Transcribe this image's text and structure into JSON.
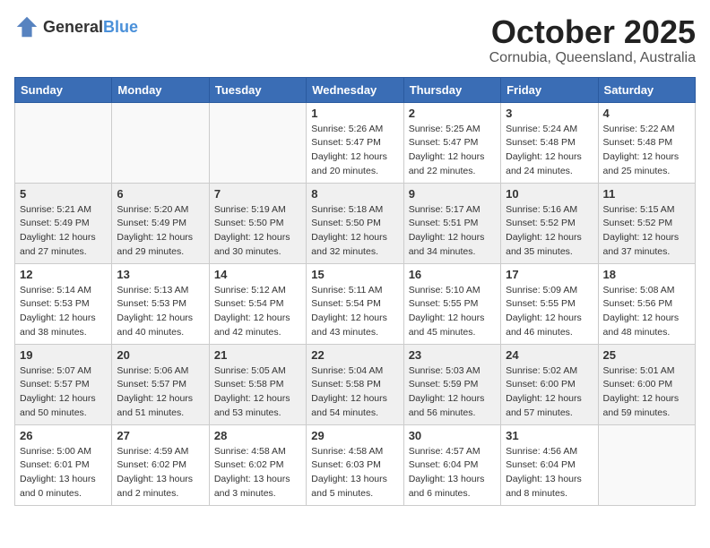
{
  "header": {
    "logo_general": "General",
    "logo_blue": "Blue",
    "month": "October 2025",
    "location": "Cornubia, Queensland, Australia"
  },
  "weekdays": [
    "Sunday",
    "Monday",
    "Tuesday",
    "Wednesday",
    "Thursday",
    "Friday",
    "Saturday"
  ],
  "weeks": [
    [
      {
        "day": "",
        "info": ""
      },
      {
        "day": "",
        "info": ""
      },
      {
        "day": "",
        "info": ""
      },
      {
        "day": "1",
        "info": "Sunrise: 5:26 AM\nSunset: 5:47 PM\nDaylight: 12 hours\nand 20 minutes."
      },
      {
        "day": "2",
        "info": "Sunrise: 5:25 AM\nSunset: 5:47 PM\nDaylight: 12 hours\nand 22 minutes."
      },
      {
        "day": "3",
        "info": "Sunrise: 5:24 AM\nSunset: 5:48 PM\nDaylight: 12 hours\nand 24 minutes."
      },
      {
        "day": "4",
        "info": "Sunrise: 5:22 AM\nSunset: 5:48 PM\nDaylight: 12 hours\nand 25 minutes."
      }
    ],
    [
      {
        "day": "5",
        "info": "Sunrise: 5:21 AM\nSunset: 5:49 PM\nDaylight: 12 hours\nand 27 minutes."
      },
      {
        "day": "6",
        "info": "Sunrise: 5:20 AM\nSunset: 5:49 PM\nDaylight: 12 hours\nand 29 minutes."
      },
      {
        "day": "7",
        "info": "Sunrise: 5:19 AM\nSunset: 5:50 PM\nDaylight: 12 hours\nand 30 minutes."
      },
      {
        "day": "8",
        "info": "Sunrise: 5:18 AM\nSunset: 5:50 PM\nDaylight: 12 hours\nand 32 minutes."
      },
      {
        "day": "9",
        "info": "Sunrise: 5:17 AM\nSunset: 5:51 PM\nDaylight: 12 hours\nand 34 minutes."
      },
      {
        "day": "10",
        "info": "Sunrise: 5:16 AM\nSunset: 5:52 PM\nDaylight: 12 hours\nand 35 minutes."
      },
      {
        "day": "11",
        "info": "Sunrise: 5:15 AM\nSunset: 5:52 PM\nDaylight: 12 hours\nand 37 minutes."
      }
    ],
    [
      {
        "day": "12",
        "info": "Sunrise: 5:14 AM\nSunset: 5:53 PM\nDaylight: 12 hours\nand 38 minutes."
      },
      {
        "day": "13",
        "info": "Sunrise: 5:13 AM\nSunset: 5:53 PM\nDaylight: 12 hours\nand 40 minutes."
      },
      {
        "day": "14",
        "info": "Sunrise: 5:12 AM\nSunset: 5:54 PM\nDaylight: 12 hours\nand 42 minutes."
      },
      {
        "day": "15",
        "info": "Sunrise: 5:11 AM\nSunset: 5:54 PM\nDaylight: 12 hours\nand 43 minutes."
      },
      {
        "day": "16",
        "info": "Sunrise: 5:10 AM\nSunset: 5:55 PM\nDaylight: 12 hours\nand 45 minutes."
      },
      {
        "day": "17",
        "info": "Sunrise: 5:09 AM\nSunset: 5:55 PM\nDaylight: 12 hours\nand 46 minutes."
      },
      {
        "day": "18",
        "info": "Sunrise: 5:08 AM\nSunset: 5:56 PM\nDaylight: 12 hours\nand 48 minutes."
      }
    ],
    [
      {
        "day": "19",
        "info": "Sunrise: 5:07 AM\nSunset: 5:57 PM\nDaylight: 12 hours\nand 50 minutes."
      },
      {
        "day": "20",
        "info": "Sunrise: 5:06 AM\nSunset: 5:57 PM\nDaylight: 12 hours\nand 51 minutes."
      },
      {
        "day": "21",
        "info": "Sunrise: 5:05 AM\nSunset: 5:58 PM\nDaylight: 12 hours\nand 53 minutes."
      },
      {
        "day": "22",
        "info": "Sunrise: 5:04 AM\nSunset: 5:58 PM\nDaylight: 12 hours\nand 54 minutes."
      },
      {
        "day": "23",
        "info": "Sunrise: 5:03 AM\nSunset: 5:59 PM\nDaylight: 12 hours\nand 56 minutes."
      },
      {
        "day": "24",
        "info": "Sunrise: 5:02 AM\nSunset: 6:00 PM\nDaylight: 12 hours\nand 57 minutes."
      },
      {
        "day": "25",
        "info": "Sunrise: 5:01 AM\nSunset: 6:00 PM\nDaylight: 12 hours\nand 59 minutes."
      }
    ],
    [
      {
        "day": "26",
        "info": "Sunrise: 5:00 AM\nSunset: 6:01 PM\nDaylight: 13 hours\nand 0 minutes."
      },
      {
        "day": "27",
        "info": "Sunrise: 4:59 AM\nSunset: 6:02 PM\nDaylight: 13 hours\nand 2 minutes."
      },
      {
        "day": "28",
        "info": "Sunrise: 4:58 AM\nSunset: 6:02 PM\nDaylight: 13 hours\nand 3 minutes."
      },
      {
        "day": "29",
        "info": "Sunrise: 4:58 AM\nSunset: 6:03 PM\nDaylight: 13 hours\nand 5 minutes."
      },
      {
        "day": "30",
        "info": "Sunrise: 4:57 AM\nSunset: 6:04 PM\nDaylight: 13 hours\nand 6 minutes."
      },
      {
        "day": "31",
        "info": "Sunrise: 4:56 AM\nSunset: 6:04 PM\nDaylight: 13 hours\nand 8 minutes."
      },
      {
        "day": "",
        "info": ""
      }
    ]
  ]
}
